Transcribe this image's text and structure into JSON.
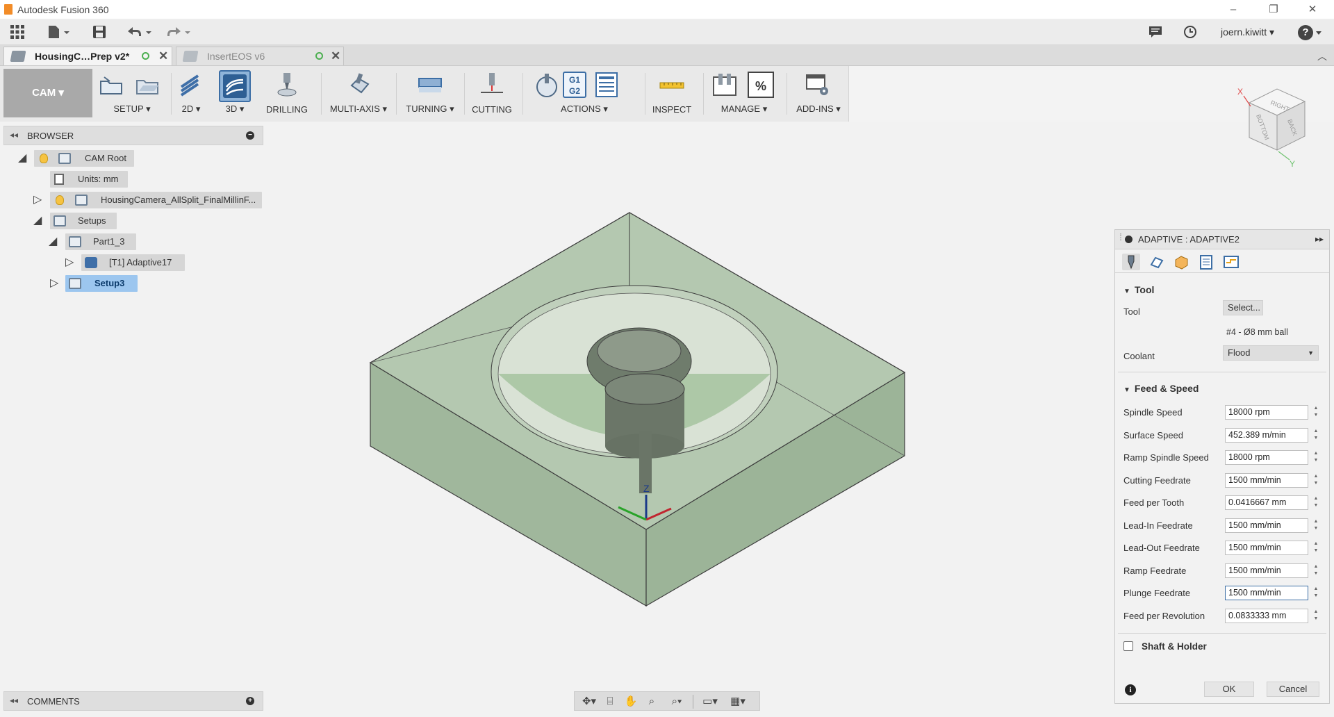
{
  "window": {
    "title": "Autodesk Fusion 360",
    "minimize": "–",
    "restore": "❐",
    "close": "✕"
  },
  "qat": {
    "user": "joern.kiwitt ▾",
    "help": "?"
  },
  "tabs": [
    {
      "label": "HousingC…Prep v2*",
      "active": true
    },
    {
      "label": "InsertEOS v6",
      "active": false
    }
  ],
  "ribbon": {
    "workspace": "CAM ▾",
    "groups": [
      {
        "label": "SETUP ▾"
      },
      {
        "label": "2D ▾"
      },
      {
        "label": "3D ▾"
      },
      {
        "label": "DRILLING"
      },
      {
        "label": "MULTI-AXIS ▾"
      },
      {
        "label": "TURNING ▾"
      },
      {
        "label": "CUTTING"
      },
      {
        "label": "ACTIONS ▾"
      },
      {
        "label": "INSPECT"
      },
      {
        "label": "MANAGE ▾"
      },
      {
        "label": "ADD-INS ▾"
      }
    ],
    "g1g2": "G1 G2",
    "percent": "%"
  },
  "browser": {
    "title": "BROWSER",
    "nodes": [
      {
        "label": "CAM Root"
      },
      {
        "label": "Units: mm"
      },
      {
        "label": "HousingCamera_AllSplit_FinalMillinF..."
      },
      {
        "label": "Setups"
      },
      {
        "label": "Part1_3"
      },
      {
        "label": "[T1] Adaptive17"
      },
      {
        "label": "Setup3"
      }
    ]
  },
  "viewcube": {
    "faces": [
      "RIGHT",
      "BOTTOM",
      "BACK"
    ],
    "axes": [
      "X",
      "Y"
    ]
  },
  "triad": {
    "z": "Z"
  },
  "panel": {
    "title": "ADAPTIVE : ADAPTIVE2",
    "tool_section": {
      "heading": "Tool",
      "tool_label": "Tool",
      "select_button": "Select...",
      "tool_desc": "#4 - Ø8 mm ball",
      "coolant_label": "Coolant",
      "coolant_value": "Flood"
    },
    "feed_section": {
      "heading": "Feed & Speed",
      "fields": [
        {
          "label": "Spindle Speed",
          "value": "18000 rpm"
        },
        {
          "label": "Surface Speed",
          "value": "452.389 m/min"
        },
        {
          "label": "Ramp Spindle Speed",
          "value": "18000 rpm"
        },
        {
          "label": "Cutting Feedrate",
          "value": "1500 mm/min"
        },
        {
          "label": "Feed per Tooth",
          "value": "0.0416667 mm"
        },
        {
          "label": "Lead-In Feedrate",
          "value": "1500 mm/min"
        },
        {
          "label": "Lead-Out Feedrate",
          "value": "1500 mm/min"
        },
        {
          "label": "Ramp Feedrate",
          "value": "1500 mm/min"
        },
        {
          "label": "Plunge Feedrate",
          "value": "1500 mm/min"
        },
        {
          "label": "Feed per Revolution",
          "value": "0.0833333 mm"
        }
      ]
    },
    "shaft_section": {
      "heading": "Shaft & Holder",
      "checked": false
    },
    "ok": "OK",
    "cancel": "Cancel"
  },
  "comments": {
    "title": "COMMENTS"
  }
}
